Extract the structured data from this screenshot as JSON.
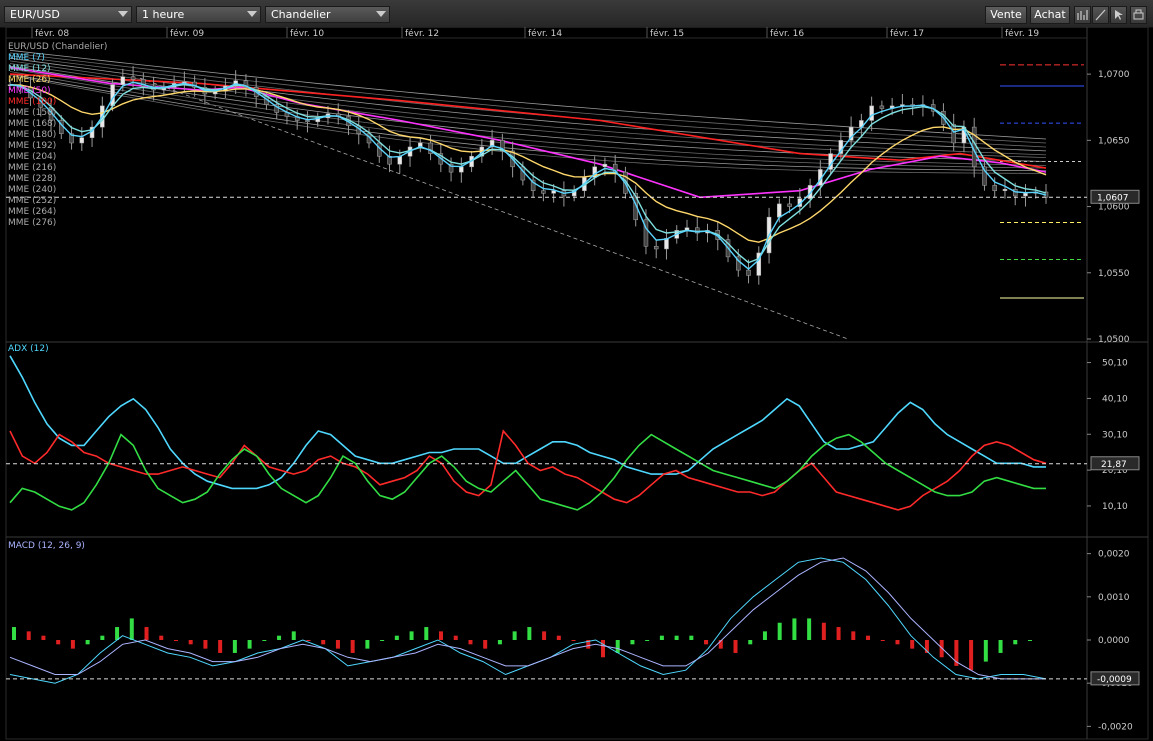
{
  "toolbar": {
    "symbol": "EUR/USD",
    "timeframe": "1 heure",
    "chart_style": "Chandelier",
    "sell_label": "Vente",
    "buy_label": "Achat",
    "icons": [
      "bar-chart-icon",
      "draw-line-icon",
      "cursor-icon",
      "print-icon"
    ]
  },
  "dates": [
    "févr. 08",
    "févr. 09",
    "févr. 10",
    "févr. 12",
    "févr. 14",
    "févr. 15",
    "févr. 16",
    "févr. 17",
    "févr. 19"
  ],
  "chart_data": [
    {
      "type": "candlestick",
      "title": "EUR/USD (Chandelier)",
      "ylim": [
        1.05,
        1.0725
      ],
      "y_ticks": [
        "1,0700",
        "1,0650",
        "1,0600",
        "1,0550",
        "1,0500"
      ],
      "last_price": "1,0607",
      "legend": [
        "EUR/USD (Chandelier)",
        "MME (7)",
        "MME (12)",
        "MME (26)",
        "MME (50)",
        "MME (100)",
        "MME (150)",
        "MME (168)",
        "MME (180)",
        "MME (192)",
        "MME (204)",
        "MME (216)",
        "MME (228)",
        "MME (240)",
        "MME (252)",
        "MME (264)",
        "MME (276)"
      ],
      "legend_colors": [
        "#aaaaaa",
        "#5ad5ff",
        "#7fe0e0",
        "#ffd86b",
        "#ff33ff",
        "#ff2a2a",
        "#aaaaaa",
        "#aaaaaa",
        "#aaaaaa",
        "#aaaaaa",
        "#aaaaaa",
        "#aaaaaa",
        "#aaaaaa",
        "#aaaaaa",
        "#aaaaaa",
        "#aaaaaa",
        "#aaaaaa"
      ],
      "close": [
        1.0692,
        1.069,
        1.0682,
        1.0675,
        1.0665,
        1.0655,
        1.0648,
        1.0652,
        1.066,
        1.0676,
        1.0692,
        1.0698,
        1.0696,
        1.0691,
        1.0688,
        1.069,
        1.0693,
        1.0694,
        1.069,
        1.0685,
        1.0687,
        1.0691,
        1.0695,
        1.069,
        1.0683,
        1.0677,
        1.0671,
        1.0668,
        1.0665,
        1.0664,
        1.0667,
        1.067,
        1.0668,
        1.0661,
        1.0655,
        1.0648,
        1.0638,
        1.0632,
        1.0638,
        1.0645,
        1.0648,
        1.064,
        1.0632,
        1.0626,
        1.063,
        1.0638,
        1.0645,
        1.065,
        1.0642,
        1.063,
        1.062,
        1.0612,
        1.061,
        1.0612,
        1.0608,
        1.0612,
        1.0622,
        1.063,
        1.0632,
        1.0626,
        1.061,
        1.059,
        1.057,
        1.0568,
        1.0576,
        1.0582,
        1.0584,
        1.058,
        1.0582,
        1.0575,
        1.0562,
        1.0552,
        1.0548,
        1.0565,
        1.0592,
        1.0602,
        1.06,
        1.0606,
        1.0616,
        1.0628,
        1.064,
        1.065,
        1.066,
        1.0665,
        1.0676,
        1.0674,
        1.0676,
        1.0677,
        1.0676,
        1.0677,
        1.0672,
        1.0662,
        1.0648,
        1.066,
        1.063,
        1.0616,
        1.0612,
        1.0613,
        1.0608,
        1.061,
        1.0611,
        1.0607
      ]
    },
    {
      "type": "line",
      "title": "ADX (12)",
      "ylim": [
        2,
        55
      ],
      "y_ticks": [
        "50,10",
        "40,10",
        "30,10",
        "20,10",
        "10,10"
      ],
      "last_value": "21,87",
      "series": [
        {
          "color": "#4fd8ff",
          "values": [
            52,
            46,
            39,
            33,
            29,
            27,
            27,
            31,
            35,
            38,
            40,
            37,
            32,
            26,
            22,
            19,
            17,
            16,
            15,
            15,
            15,
            16,
            18,
            22,
            27,
            31,
            30,
            27,
            24,
            23,
            22,
            22,
            23,
            24,
            25,
            25,
            26,
            26,
            26,
            24,
            22,
            22,
            24,
            26,
            28,
            28,
            27,
            25,
            24,
            23,
            21,
            20,
            19,
            19,
            19,
            20,
            23,
            26,
            28,
            30,
            32,
            34,
            37,
            40,
            38,
            33,
            28,
            26,
            26,
            27,
            28,
            32,
            36,
            39,
            37,
            33,
            30,
            28,
            26,
            24,
            22,
            22,
            22,
            21,
            21
          ]
        },
        {
          "color": "#ff2a2a",
          "values": [
            31,
            24,
            22,
            25,
            30,
            28,
            25,
            24,
            22,
            21,
            20,
            19,
            19,
            20,
            21,
            20,
            19,
            18,
            22,
            27,
            24,
            21,
            20,
            19,
            20,
            23,
            24,
            22,
            21,
            19,
            16,
            17,
            18,
            20,
            24,
            22,
            17,
            14,
            13,
            16,
            31,
            27,
            22,
            20,
            21,
            19,
            18,
            16,
            14,
            12,
            11,
            13,
            16,
            19,
            20,
            18,
            17,
            16,
            15,
            14,
            14,
            13,
            14,
            17,
            20,
            22,
            18,
            14,
            13,
            12,
            11,
            10,
            9,
            10,
            13,
            15,
            17,
            20,
            24,
            27,
            28,
            27,
            25,
            23,
            22
          ]
        },
        {
          "color": "#33dd44",
          "values": [
            11,
            15,
            14,
            12,
            10,
            9,
            11,
            16,
            22,
            30,
            27,
            20,
            15,
            13,
            11,
            12,
            14,
            19,
            23,
            26,
            24,
            19,
            15,
            13,
            11,
            13,
            18,
            24,
            22,
            17,
            13,
            12,
            14,
            18,
            22,
            24,
            21,
            17,
            15,
            14,
            17,
            20,
            16,
            12,
            11,
            10,
            9,
            11,
            14,
            18,
            23,
            27,
            30,
            28,
            26,
            24,
            22,
            20,
            19,
            18,
            17,
            16,
            15,
            17,
            20,
            24,
            27,
            29,
            30,
            28,
            25,
            22,
            20,
            18,
            16,
            14,
            13,
            13,
            14,
            17,
            18,
            17,
            16,
            15,
            15
          ]
        }
      ]
    },
    {
      "type": "bar+line",
      "title": "MACD (12, 26, 9)",
      "ylim": [
        -0.0022,
        0.0022
      ],
      "y_ticks": [
        "0,0020",
        "0,0010",
        "0,0000",
        "-0,0010",
        "-0,0020"
      ],
      "last_value": "-0,0009",
      "histogram": [
        0.0003,
        0.0002,
        0.0001,
        -0.0001,
        -0.0002,
        -0.0001,
        0.0001,
        0.0003,
        0.0005,
        0.0003,
        0.0001,
        0.0,
        -0.0001,
        -0.0002,
        -0.0003,
        -0.0003,
        -0.0002,
        0.0,
        0.0001,
        0.0002,
        0.0,
        -0.0001,
        -0.0002,
        -0.0003,
        -0.0002,
        0.0,
        0.0001,
        0.0002,
        0.0003,
        0.0002,
        0.0001,
        -0.0001,
        -0.0002,
        -0.0001,
        0.0002,
        0.0003,
        0.0002,
        0.0001,
        0.0,
        -0.0002,
        -0.0004,
        -0.0003,
        -0.0001,
        0.0,
        0.0001,
        0.0001,
        0.0001,
        -0.0001,
        -0.0002,
        -0.0003,
        -0.0001,
        0.0002,
        0.0004,
        0.0005,
        0.0005,
        0.0004,
        0.0003,
        0.0002,
        0.0001,
        0.0,
        -0.0001,
        -0.0002,
        -0.0003,
        -0.0004,
        -0.0006,
        -0.0007,
        -0.0005,
        -0.0003,
        -0.0001,
        0.0
      ],
      "series": [
        {
          "color": "#4fd8ff",
          "values": [
            -0.0008,
            -0.0009,
            -0.001,
            -0.0008,
            -0.0003,
            0.0001,
            -0.0001,
            -0.0003,
            -0.0004,
            -0.0006,
            -0.0005,
            -0.0003,
            -0.0002,
            0.0,
            -0.0002,
            -0.0006,
            -0.0005,
            -0.0004,
            -0.0002,
            0.0,
            -0.0003,
            -0.0005,
            -0.0008,
            -0.0006,
            -0.0004,
            -0.0001,
            0.0,
            -0.0003,
            -0.0006,
            -0.0008,
            -0.0007,
            -0.0002,
            0.0005,
            0.001,
            0.0014,
            0.0018,
            0.0019,
            0.0018,
            0.0014,
            0.0008,
            0.0001,
            -0.0004,
            -0.0008,
            -0.0009,
            -0.0008,
            -0.0008,
            -0.0009
          ]
        },
        {
          "color": "#aab4ff",
          "values": [
            -0.0004,
            -0.0006,
            -0.0008,
            -0.0008,
            -0.0005,
            -0.0001,
            0.0,
            -0.0002,
            -0.0003,
            -0.0005,
            -0.0005,
            -0.0004,
            -0.0002,
            -0.0001,
            -0.0002,
            -0.0004,
            -0.0005,
            -0.0004,
            -0.0003,
            -0.0001,
            -0.0002,
            -0.0004,
            -0.0006,
            -0.0006,
            -0.0004,
            -0.0002,
            -0.0001,
            -0.0002,
            -0.0004,
            -0.0006,
            -0.0006,
            -0.0003,
            0.0002,
            0.0007,
            0.0011,
            0.0015,
            0.0018,
            0.0019,
            0.0016,
            0.0011,
            0.0005,
            0.0,
            -0.0005,
            -0.0008,
            -0.0009,
            -0.0009,
            -0.0009
          ]
        }
      ]
    }
  ]
}
